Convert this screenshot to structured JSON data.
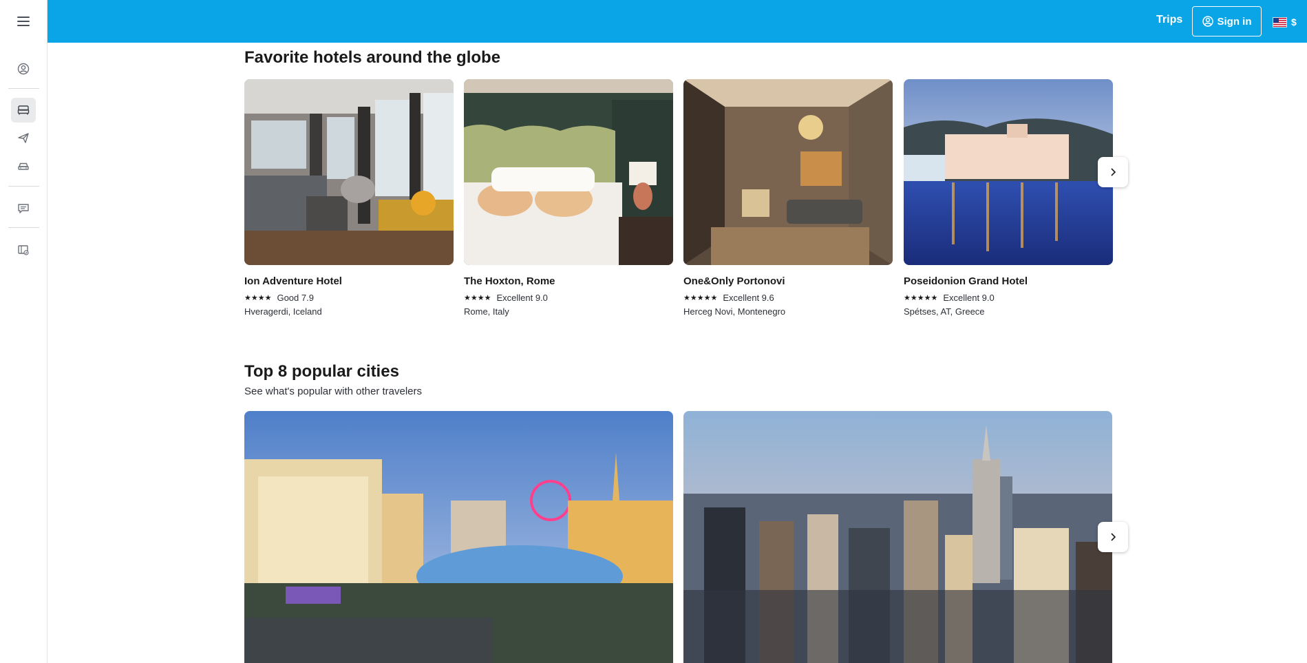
{
  "header": {
    "trips_label": "Trips",
    "sign_in_label": "Sign in",
    "currency": "$",
    "icons": {
      "menu": "hamburger-menu-icon",
      "user": "user-circle-icon",
      "flag": "us-flag-icon"
    },
    "colors": {
      "bar": "#0aa5e6",
      "text": "#ffffff"
    }
  },
  "sidebar": {
    "items": [
      {
        "icon": "account-circle-icon"
      },
      {
        "icon": "bed-icon",
        "active": true
      },
      {
        "icon": "plane-icon"
      },
      {
        "icon": "car-icon"
      },
      {
        "icon": "chat-icon"
      },
      {
        "icon": "trips-ticket-icon"
      }
    ]
  },
  "hotels_section": {
    "title": "Favorite hotels around the globe",
    "hotels": [
      {
        "name": "Ion Adventure Hotel",
        "stars": "★★★★",
        "rating": "Good 7.9",
        "location": "Hveragerdi, Iceland"
      },
      {
        "name": "The Hoxton, Rome",
        "stars": "★★★★",
        "rating": "Excellent 9.0",
        "location": "Rome, Italy"
      },
      {
        "name": "One&Only Portonovi",
        "stars": "★★★★★",
        "rating": "Excellent 9.6",
        "location": "Herceg Novi, Montenegro"
      },
      {
        "name": "Poseidonion Grand Hotel",
        "stars": "★★★★★",
        "rating": "Excellent 9.0",
        "location": "Spétses, AT, Greece"
      }
    ]
  },
  "cities_section": {
    "title": "Top 8 popular cities",
    "subtitle": "See what's popular with other travelers"
  }
}
